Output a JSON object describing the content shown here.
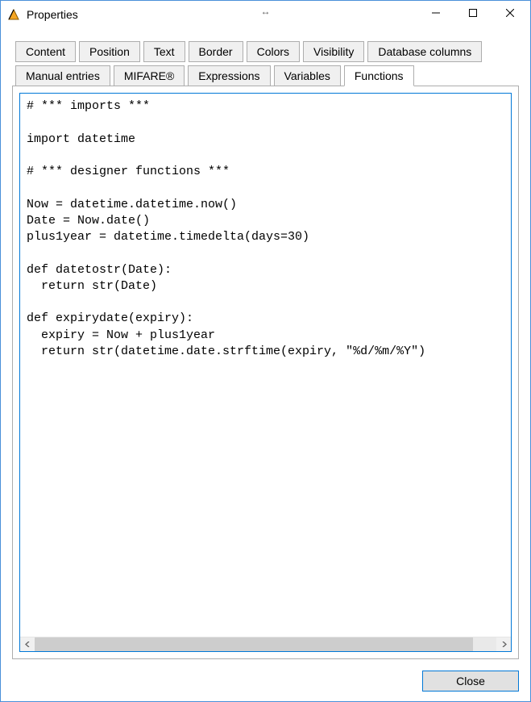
{
  "window": {
    "title": "Properties"
  },
  "tabs": {
    "row1": [
      {
        "id": "content",
        "label": "Content",
        "active": false
      },
      {
        "id": "position",
        "label": "Position",
        "active": false
      },
      {
        "id": "text",
        "label": "Text",
        "active": false
      },
      {
        "id": "border",
        "label": "Border",
        "active": false
      },
      {
        "id": "colors",
        "label": "Colors",
        "active": false
      },
      {
        "id": "visibility",
        "label": "Visibility",
        "active": false
      },
      {
        "id": "database-columns",
        "label": "Database columns",
        "active": false
      }
    ],
    "row2": [
      {
        "id": "manual-entries",
        "label": "Manual entries",
        "active": false
      },
      {
        "id": "mifare",
        "label": "MIFARE®",
        "active": false
      },
      {
        "id": "expressions",
        "label": "Expressions",
        "active": false
      },
      {
        "id": "variables",
        "label": "Variables",
        "active": false
      },
      {
        "id": "functions",
        "label": "Functions",
        "active": true
      }
    ],
    "active_tab": "functions"
  },
  "editor": {
    "code": "# *** imports ***\n\nimport datetime\n\n# *** designer functions ***\n\nNow = datetime.datetime.now()\nDate = Now.date()\nplus1year = datetime.timedelta(days=30)\n\ndef datetostr(Date):\n  return str(Date)\n\ndef expirydate(expiry):\n  expiry = Now + plus1year\n  return str(datetime.date.strftime(expiry, \"%d/%m/%Y\")\n"
  },
  "buttons": {
    "close": "Close"
  },
  "icons": {
    "resize_horizontal": "↔"
  }
}
